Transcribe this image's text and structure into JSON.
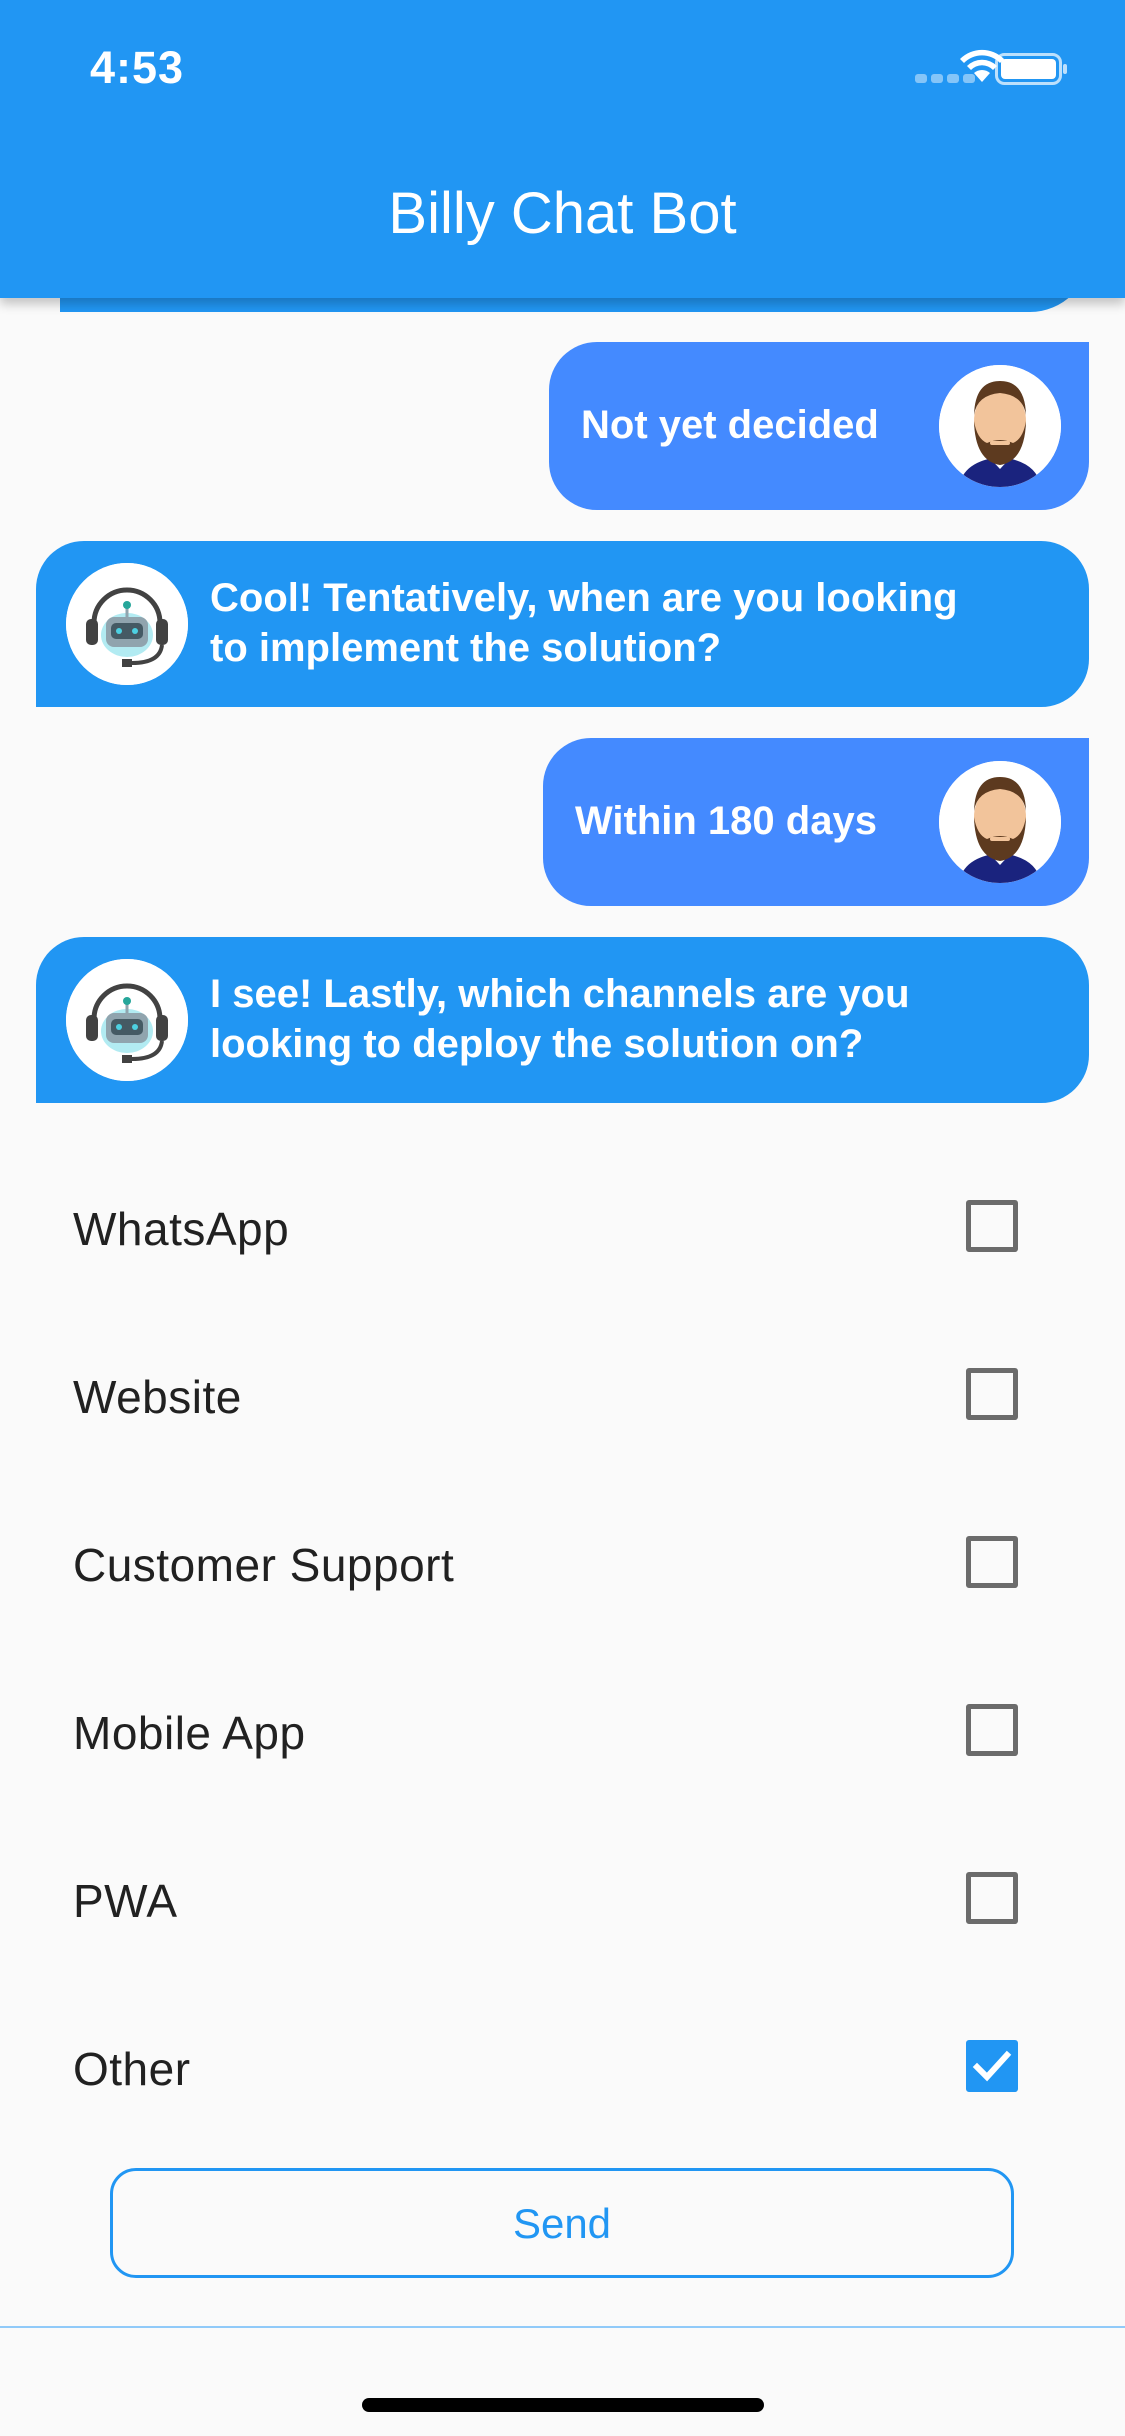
{
  "status": {
    "time": "4:53"
  },
  "header": {
    "title": "Billy Chat Bot"
  },
  "messages": [
    {
      "from": "user",
      "text": "Not yet decided"
    },
    {
      "from": "bot",
      "line1": "Cool! Tentatively, when are you looking",
      "line2": "to implement the solution?"
    },
    {
      "from": "user",
      "text": "Within 180 days"
    },
    {
      "from": "bot",
      "line1": "I see! Lastly, which channels are you",
      "line2": "looking to deploy the solution on?"
    }
  ],
  "options": [
    {
      "label": "WhatsApp",
      "checked": false
    },
    {
      "label": "Website",
      "checked": false
    },
    {
      "label": "Customer Support",
      "checked": false
    },
    {
      "label": "Mobile App",
      "checked": false
    },
    {
      "label": "PWA",
      "checked": false
    },
    {
      "label": "Other",
      "checked": true
    }
  ],
  "send_label": "Send",
  "colors": {
    "appbar": "#2196f3",
    "user_bubble": "#448aff",
    "bot_bubble": "#2196f3"
  }
}
